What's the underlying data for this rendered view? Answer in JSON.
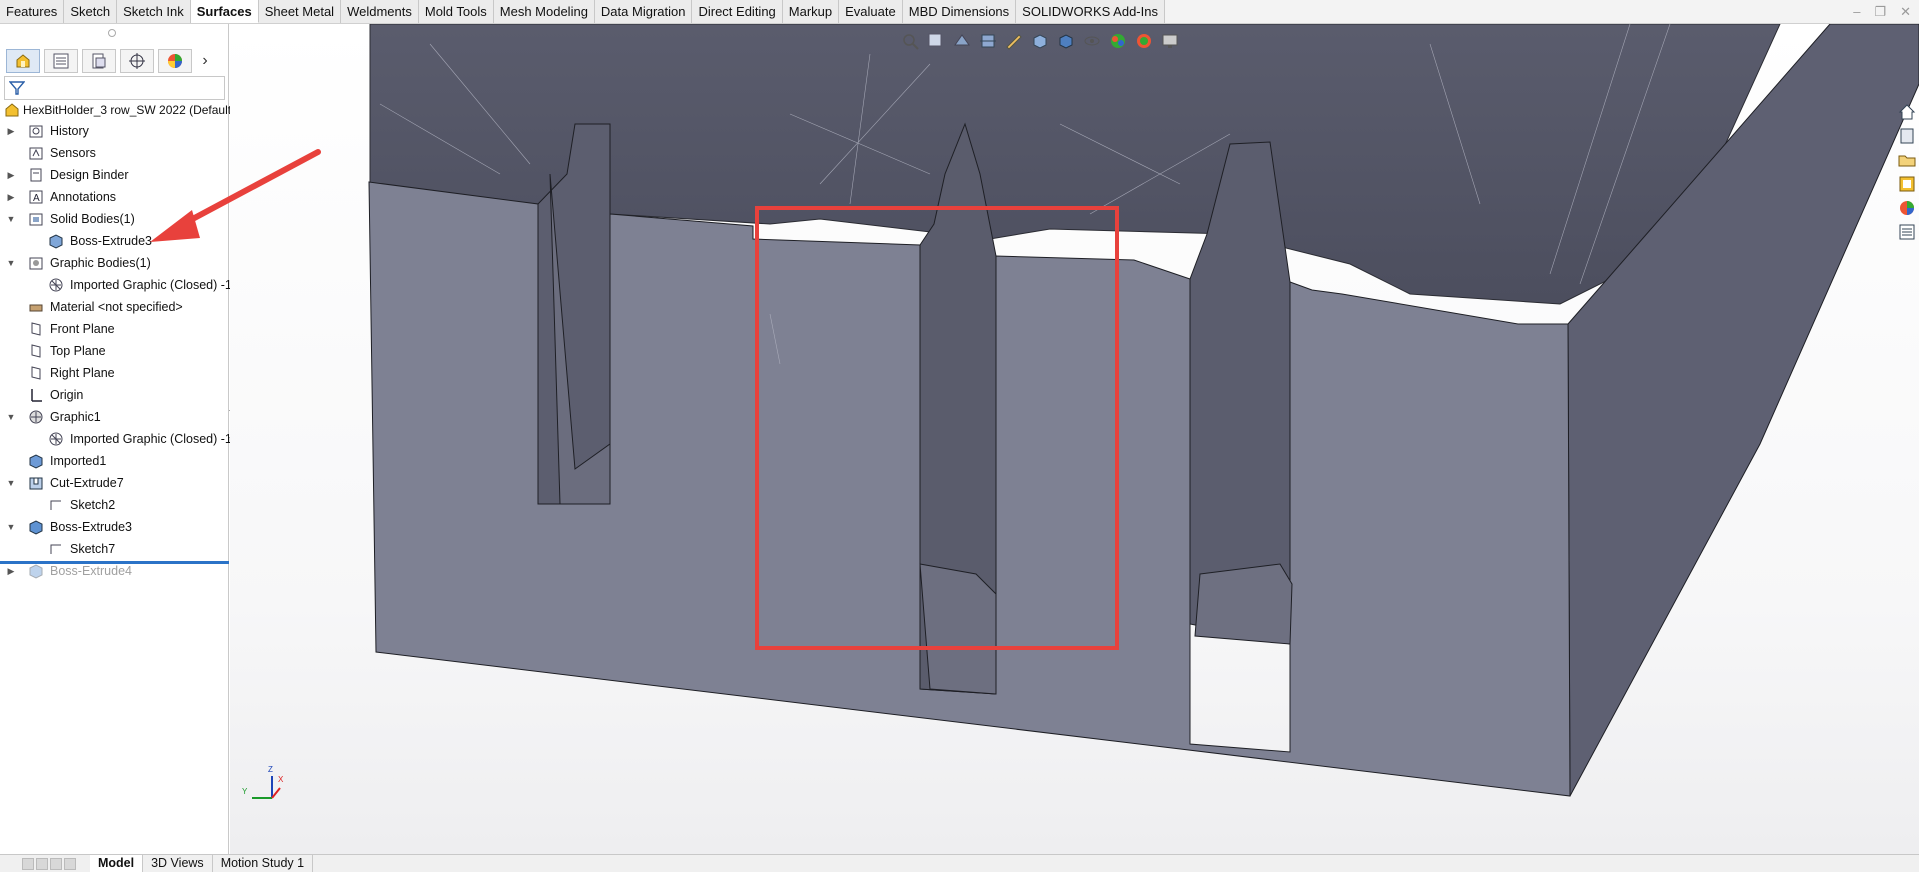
{
  "tabs": [
    "Features",
    "Sketch",
    "Sketch Ink",
    "Surfaces",
    "Sheet Metal",
    "Weldments",
    "Mold Tools",
    "Mesh Modeling",
    "Data Migration",
    "Direct Editing",
    "Markup",
    "Evaluate",
    "MBD Dimensions",
    "SOLIDWORKS Add-Ins"
  ],
  "active_tab": "Surfaces",
  "tree": {
    "root": "HexBitHolder_3 row_SW 2022  (Default",
    "items": [
      {
        "label": "History",
        "toggle": "▶",
        "icon": "history-icon",
        "indent": 0
      },
      {
        "label": "Sensors",
        "toggle": "",
        "icon": "sensors-icon",
        "indent": 0
      },
      {
        "label": "Design Binder",
        "toggle": "▶",
        "icon": "design-binder-icon",
        "indent": 0
      },
      {
        "label": "Annotations",
        "toggle": "▶",
        "icon": "annotations-icon",
        "indent": 0
      },
      {
        "label": "Solid Bodies(1)",
        "toggle": "▼",
        "icon": "solid-bodies-icon",
        "indent": 0
      },
      {
        "label": "Boss-Extrude3",
        "toggle": "",
        "icon": "solid-body-icon",
        "indent": 1
      },
      {
        "label": "Graphic Bodies(1)",
        "toggle": "▼",
        "icon": "graphic-bodies-icon",
        "indent": 0
      },
      {
        "label": "Imported Graphic (Closed) -1",
        "toggle": "",
        "icon": "graphic-body-icon",
        "indent": 1
      },
      {
        "label": "Material <not specified>",
        "toggle": "",
        "icon": "material-icon",
        "indent": 0
      },
      {
        "label": "Front Plane",
        "toggle": "",
        "icon": "plane-icon",
        "indent": 0
      },
      {
        "label": "Top Plane",
        "toggle": "",
        "icon": "plane-icon",
        "indent": 0
      },
      {
        "label": "Right Plane",
        "toggle": "",
        "icon": "plane-icon",
        "indent": 0
      },
      {
        "label": "Origin",
        "toggle": "",
        "icon": "origin-icon",
        "indent": 0
      },
      {
        "label": "Graphic1",
        "toggle": "▼",
        "icon": "graphic-feature-icon",
        "indent": 0
      },
      {
        "label": "Imported Graphic (Closed) -1",
        "toggle": "",
        "icon": "graphic-body-icon",
        "indent": 1
      },
      {
        "label": "Imported1",
        "toggle": "",
        "icon": "imported-icon",
        "indent": 0
      },
      {
        "label": "Cut-Extrude7",
        "toggle": "▼",
        "icon": "cut-extrude-icon",
        "indent": 0
      },
      {
        "label": "Sketch2",
        "toggle": "",
        "icon": "sketch-icon",
        "indent": 1
      },
      {
        "label": "Boss-Extrude3",
        "toggle": "▼",
        "icon": "boss-extrude-icon",
        "indent": 0
      },
      {
        "label": "Sketch7",
        "toggle": "",
        "icon": "sketch-icon",
        "indent": 1
      },
      {
        "label": "Boss-Extrude4",
        "toggle": "▶",
        "icon": "boss-extrude-icon",
        "indent": 0,
        "suppressed": true
      }
    ]
  },
  "bottom_tabs": [
    "Model",
    "3D Views",
    "Motion Study 1"
  ],
  "active_bottom_tab": "Model",
  "triad": {
    "x": "X",
    "y": "Y",
    "z": "Z"
  },
  "colors": {
    "annotation_red": "#e8413c",
    "rollback_bar": "#2b73c7",
    "model_face": "#7e8193",
    "model_top": "#56586a"
  }
}
